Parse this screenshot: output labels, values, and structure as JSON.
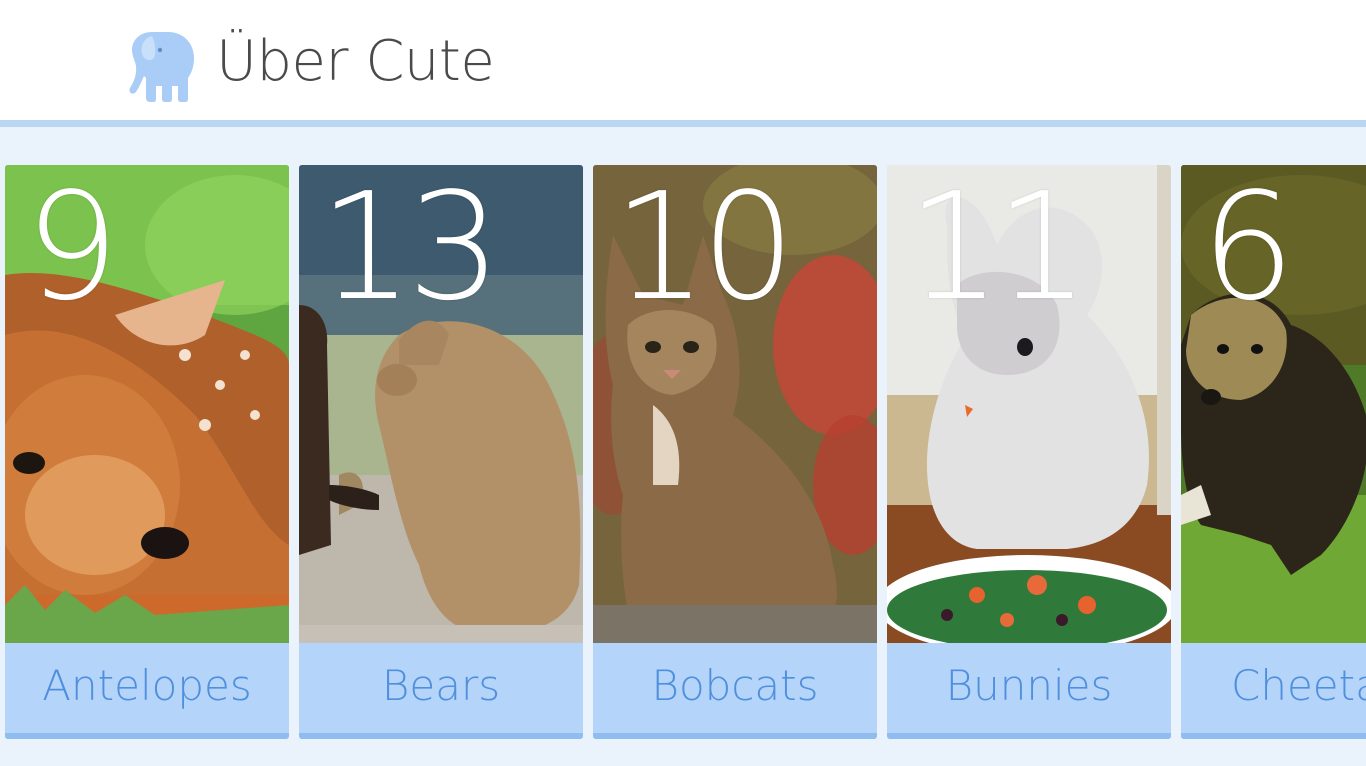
{
  "app": {
    "title": "Über Cute",
    "logo_icon": "elephant-icon",
    "logo_color": "#a9cdf7"
  },
  "colors": {
    "header_rule": "#b9d6f5",
    "content_bg": "#eaf2fc",
    "label_bar": "#b4d4fa",
    "label_text": "#4f8fdc"
  },
  "categories": [
    {
      "label": "Antelopes",
      "count": "9",
      "photo": "fawn-photo"
    },
    {
      "label": "Bears",
      "count": "13",
      "photo": "bear-cubs-photo"
    },
    {
      "label": "Bobcats",
      "count": "10",
      "photo": "bobcat-kitten-photo"
    },
    {
      "label": "Bunnies",
      "count": "11",
      "photo": "bunny-photo"
    },
    {
      "label": "Cheeta",
      "count": "6",
      "photo": "cheetah-cub-photo"
    }
  ]
}
